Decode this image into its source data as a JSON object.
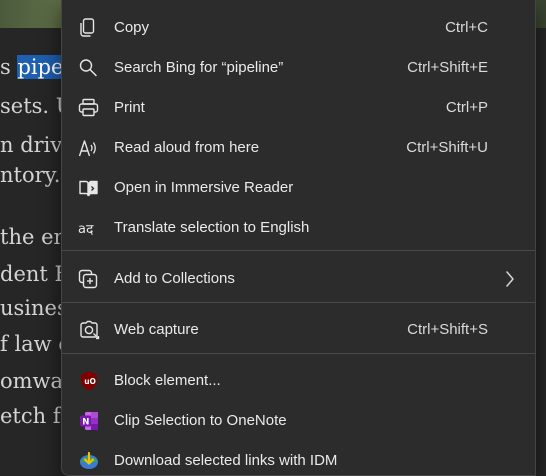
{
  "article": {
    "lines": [
      {
        "before": "s ",
        "selected": "pipel",
        "after": ""
      },
      {
        "before": "sets. Ur",
        "selected": "",
        "after": ""
      },
      {
        "before": "n drive",
        "selected": "",
        "after": ""
      },
      {
        "before": "ntory.",
        "selected": "",
        "after": ""
      },
      {
        "before": "the enc",
        "selected": "",
        "after": ""
      },
      {
        "before": "dent B",
        "selected": "",
        "after": ""
      },
      {
        "before": "usiness",
        "selected": "",
        "after": ""
      },
      {
        "before": "f law e",
        "selected": "",
        "after": ""
      },
      {
        "before": "omwar",
        "selected": "",
        "after": ""
      },
      {
        "before": "etch fo",
        "selected": "",
        "after": ""
      }
    ]
  },
  "context_menu": {
    "groups": [
      {
        "items": [
          {
            "label": "Copy",
            "shortcut": "Ctrl+C",
            "icon": "copy-icon"
          },
          {
            "label": "Search Bing for “pipeline”",
            "shortcut": "Ctrl+Shift+E",
            "icon": "search-icon"
          },
          {
            "label": "Print",
            "shortcut": "Ctrl+P",
            "icon": "printer-icon"
          },
          {
            "label": "Read aloud from here",
            "shortcut": "Ctrl+Shift+U",
            "icon": "read-aloud-icon"
          },
          {
            "label": "Open in Immersive Reader",
            "shortcut": "",
            "icon": "immersive-reader-icon"
          },
          {
            "label": "Translate selection to English",
            "shortcut": "",
            "icon": "translate-icon"
          }
        ]
      },
      {
        "items": [
          {
            "label": "Add to Collections",
            "shortcut": "",
            "icon": "collections-icon",
            "has_submenu": true
          }
        ]
      },
      {
        "items": [
          {
            "label": "Web capture",
            "shortcut": "Ctrl+Shift+S",
            "icon": "web-capture-icon"
          }
        ]
      },
      {
        "items": [
          {
            "label": "Block element...",
            "shortcut": "",
            "icon": "ublock-icon"
          },
          {
            "label": "Clip Selection to OneNote",
            "shortcut": "",
            "icon": "onenote-icon"
          },
          {
            "label": "Download selected links with IDM",
            "shortcut": "",
            "icon": "idm-download-icon"
          }
        ]
      }
    ]
  },
  "colors": {
    "menu_background": "#2c2c2c",
    "selection_highlight": "#1d5fb0",
    "ublock_red": "#800000",
    "onenote_purple": "#7719aa",
    "idm_green": "#3aa845"
  }
}
